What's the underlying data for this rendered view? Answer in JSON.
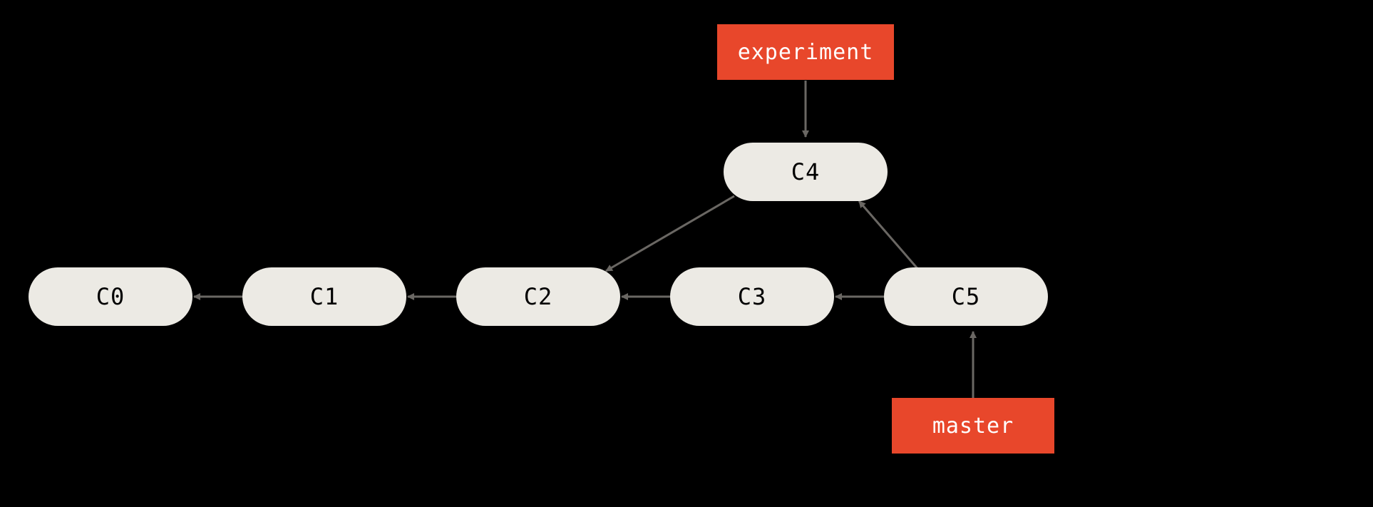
{
  "commits": {
    "c0": "C0",
    "c1": "C1",
    "c2": "C2",
    "c3": "C3",
    "c4": "C4",
    "c5": "C5"
  },
  "branches": {
    "experiment": "experiment",
    "master": "master"
  },
  "relations": {
    "parent_edges": [
      [
        "C1",
        "C0"
      ],
      [
        "C2",
        "C1"
      ],
      [
        "C3",
        "C2"
      ],
      [
        "C4",
        "C2"
      ],
      [
        "C5",
        "C3"
      ],
      [
        "C5",
        "C4"
      ]
    ],
    "branch_pointers": {
      "experiment": "C4",
      "master": "C5"
    }
  },
  "colors": {
    "node_fill": "#ECEAE4",
    "branch_fill": "#E8472B",
    "background": "#000000",
    "arrow": "#6A6763"
  }
}
